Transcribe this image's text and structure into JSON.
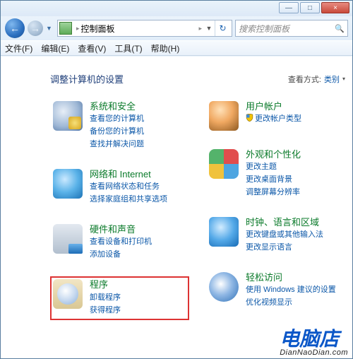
{
  "window": {
    "minimize": "—",
    "maximize": "□",
    "close": "×"
  },
  "nav": {
    "back": "←",
    "forward": "→",
    "history_drop": "▼",
    "refresh": "↻"
  },
  "address": {
    "root_sep": "▸",
    "location": "控制面板",
    "sep": "▸",
    "dropdown": "▼"
  },
  "search": {
    "placeholder": "搜索控制面板",
    "icon": "🔍"
  },
  "menu": {
    "file": "文件(F)",
    "edit": "编辑(E)",
    "view": "查看(V)",
    "tools": "工具(T)",
    "help": "帮助(H)"
  },
  "heading": "调整计算机的设置",
  "viewby": {
    "label": "查看方式:",
    "value": "类别",
    "drop": "▾"
  },
  "left": [
    {
      "id": "system-security",
      "title": "系统和安全",
      "links": [
        "查看您的计算机",
        "备份您的计算机",
        "查找并解决问题"
      ],
      "shielded": []
    },
    {
      "id": "network-internet",
      "title": "网络和 Internet",
      "links": [
        "查看网络状态和任务",
        "选择家庭组和共享选项"
      ],
      "shielded": []
    },
    {
      "id": "hardware-sound",
      "title": "硬件和声音",
      "links": [
        "查看设备和打印机",
        "添加设备"
      ],
      "shielded": []
    },
    {
      "id": "programs",
      "title": "程序",
      "links": [
        "卸载程序",
        "获得程序"
      ],
      "shielded": [],
      "highlight": true
    }
  ],
  "right": [
    {
      "id": "user-accounts",
      "title": "用户帐户",
      "links": [
        "更改帐户类型"
      ],
      "shielded": [
        0
      ]
    },
    {
      "id": "appearance",
      "title": "外观和个性化",
      "links": [
        "更改主题",
        "更改桌面背景",
        "调整屏幕分辨率"
      ],
      "shielded": []
    },
    {
      "id": "clock-language-region",
      "title": "时钟、语言和区域",
      "links": [
        "更改键盘或其他输入法",
        "更改显示语言"
      ],
      "shielded": []
    },
    {
      "id": "ease-of-access",
      "title": "轻松访问",
      "links": [
        "使用 Windows 建议的设置",
        "优化视频显示"
      ],
      "shielded": []
    }
  ],
  "watermark": {
    "main": "电脑店",
    "sub": "DianNaoDian.com"
  }
}
